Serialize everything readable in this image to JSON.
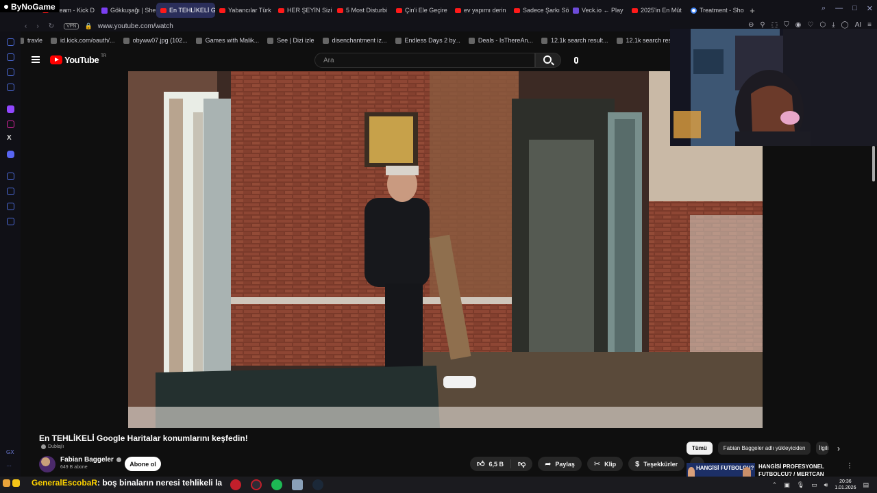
{
  "overlay": {
    "brand": "ByNoGame"
  },
  "browser": {
    "tabs": [
      {
        "label": "Stream - Kick D",
        "icon": "kick-icon"
      },
      {
        "label": "Gökkuşağı | She",
        "icon": "site-icon"
      },
      {
        "label": "En TEHLİKELİ Google",
        "icon": "youtube-icon",
        "active": true
      },
      {
        "label": "Yabancılar Türk",
        "icon": "youtube-icon"
      },
      {
        "label": "HER ŞEYİN Sizi",
        "icon": "youtube-icon"
      },
      {
        "label": "5 Most Disturbi",
        "icon": "youtube-icon"
      },
      {
        "label": "Çin'i Ele Geçire",
        "icon": "youtube-icon"
      },
      {
        "label": "ev yapımı derin",
        "icon": "youtube-icon"
      },
      {
        "label": "Sadece Şarkı Sö",
        "icon": "youtube-icon"
      },
      {
        "label": "Veck.io ← Play",
        "icon": "veck-icon"
      },
      {
        "label": "2025'in En Müt",
        "icon": "youtube-icon"
      },
      {
        "label": "Treatment - Sho",
        "icon": "google-icon"
      }
    ],
    "new_tab": "+",
    "vpn": "VPN",
    "url": "www.youtube.com/watch",
    "bookmarks": [
      "travle",
      "id.kick.com/oauth/...",
      "obyww07.jpg (102...",
      "Games with Malik...",
      "See | Dizi izle",
      "disenchantment iz...",
      "Endless Days 2 by...",
      "Deals - IsThereAn...",
      "12.1k search result...",
      "12.1k search result..."
    ],
    "ai_label": "AI",
    "sidebar_bottom_label": "GX"
  },
  "youtube": {
    "logo": "YouTube",
    "country": "TR",
    "search_placeholder": "Ara",
    "video_title": "En TEHLİKELİ Google Haritalar konumlarını keşfedin!",
    "dubbed": "Dublajlı",
    "channel_name": "Fabian Baggeler",
    "subscribers": "649 B abone",
    "subscribe_label": "Abone ol",
    "likes": "6,5 B",
    "share_label": "Paylaş",
    "clip_label": "Klip",
    "thanks_label": "Teşekkürler",
    "more_label": "...",
    "chips": [
      "Tümü",
      "Fabian Baggeler adlı yükleyiciden",
      "İlgili"
    ],
    "rec_thumb_text": "HANGİSİ FUTBOLCU?",
    "rec_title": "HANGİSİ PROFESYONEL FUTBOLCU? / MERTCAN"
  },
  "taskbar": {
    "chat_user": "GeneralEscobaR",
    "chat_message": ": boş binaların neresi tehlikeli la",
    "time": "20:36",
    "date": "1.01.2026"
  }
}
